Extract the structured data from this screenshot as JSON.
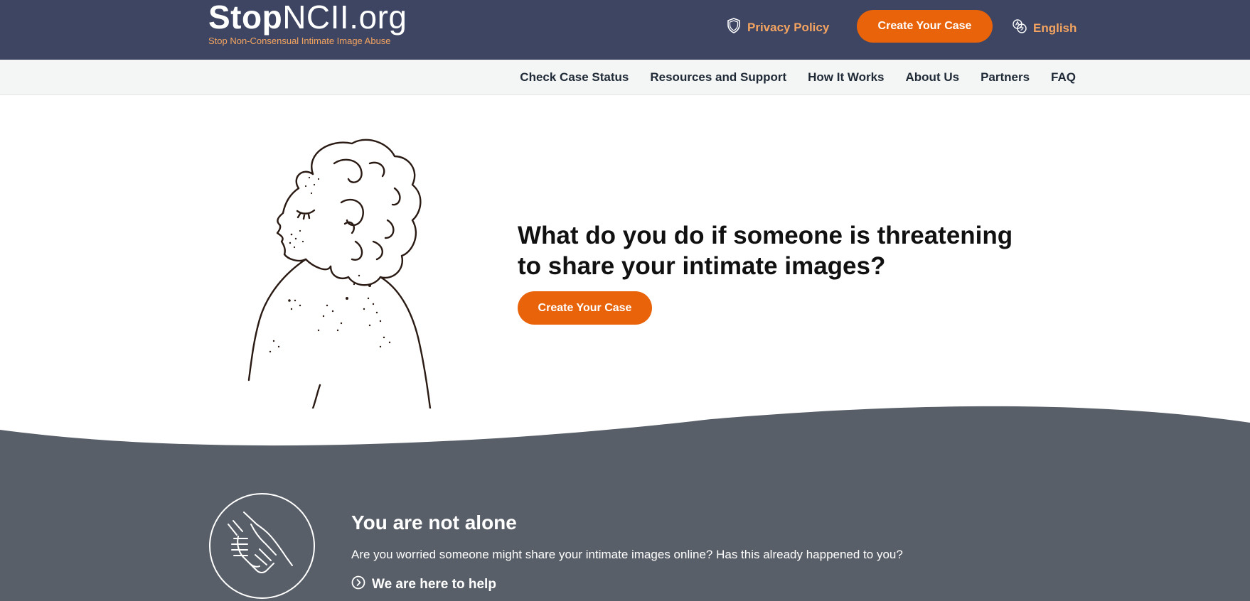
{
  "header": {
    "logo_bold": "Stop",
    "logo_rest": "NCII.org",
    "tagline": "Stop Non-Consensual Intimate Image Abuse",
    "privacy_label": "Privacy Policy",
    "create_label": "Create Your Case",
    "language_label": "English"
  },
  "nav": {
    "items": [
      "Check Case Status",
      "Resources and Support",
      "How It Works",
      "About Us",
      "Partners",
      "FAQ"
    ]
  },
  "hero": {
    "q_part1": "What do you do if someone is ",
    "q_bold": "threatening to share",
    "q_part2": " your intimate images?",
    "create_label": "Create Your Case"
  },
  "support": {
    "title": "You are not alone",
    "subtitle": "Are you worried someone might share your intimate images online? Has this already happened to you?",
    "link_label": "We are here to help"
  },
  "colors": {
    "header_bg": "#3d4562",
    "accent": "#e8630a",
    "accent_text": "#f4a460",
    "dark_section": "#595f68"
  },
  "icons": [
    "shield-icon",
    "language-icon",
    "helping-hands-icon",
    "chevron-right-circle-icon"
  ]
}
